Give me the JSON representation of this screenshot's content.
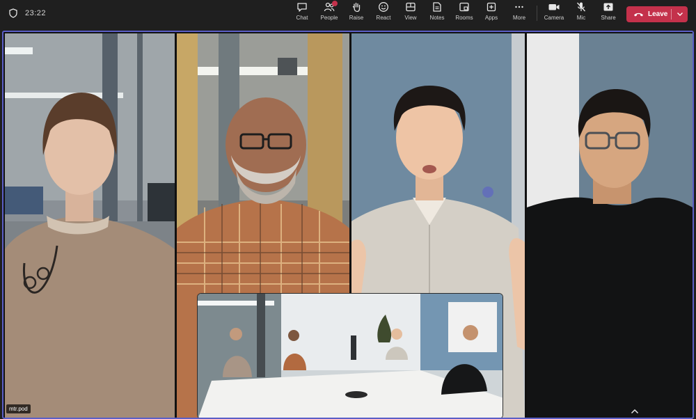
{
  "meeting": {
    "timer": "23:22"
  },
  "toolbar": {
    "items": [
      {
        "label": "Chat"
      },
      {
        "label": "People"
      },
      {
        "label": "Raise"
      },
      {
        "label": "React"
      },
      {
        "label": "View"
      },
      {
        "label": "Notes"
      },
      {
        "label": "Rooms"
      },
      {
        "label": "Apps"
      },
      {
        "label": "More"
      }
    ],
    "controls": [
      {
        "label": "Camera"
      },
      {
        "label": "Mic"
      },
      {
        "label": "Share"
      }
    ],
    "leave_label": "Leave"
  },
  "stage": {
    "name_label": "mtr.pod"
  },
  "colors": {
    "accent": "#5b5fc7",
    "leave": "#c4314b",
    "bar": "#1f1f1f"
  }
}
